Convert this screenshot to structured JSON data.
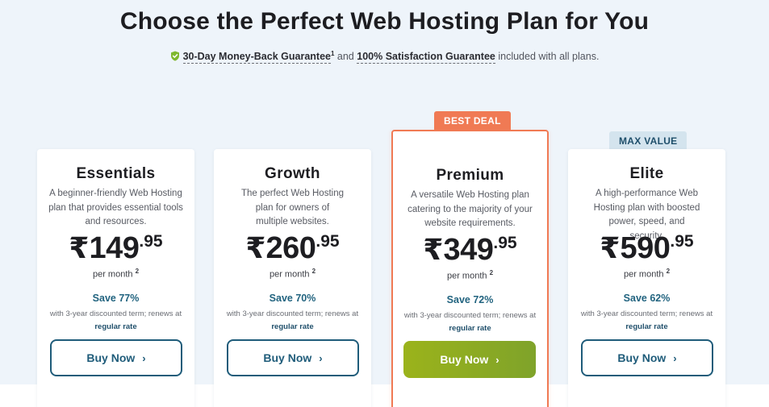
{
  "header": {
    "title": "Choose the Perfect Web Hosting Plan for You",
    "money_back": "30-Day Money-Back Guarantee",
    "money_back_sup": "1",
    "and_text": "and",
    "satisfaction": "100% Satisfaction Guarantee",
    "suffix": "included with all plans."
  },
  "colors": {
    "accent_orange": "#f07a54",
    "brand_blue": "#1f5c7a",
    "buy_green": "#8faf22",
    "shield_green": "#7fb82e"
  },
  "plans": [
    {
      "name": "Essentials",
      "badge": "",
      "description": "A beginner-friendly Web Hosting plan that provides essential tools and resources.",
      "currency": "₹",
      "price_main": "149",
      "price_cents": ".95",
      "per_month": "per month",
      "per_month_sup": "2",
      "save": "Save 77%",
      "terms_text": "with 3-year discounted term; renews at",
      "terms_link": "regular rate",
      "button": "Buy Now"
    },
    {
      "name": "Growth",
      "badge": "",
      "description": "The perfect Web Hosting plan for owners of multiple websites.",
      "currency": "₹",
      "price_main": "260",
      "price_cents": ".95",
      "per_month": "per month",
      "per_month_sup": "2",
      "save": "Save 70%",
      "terms_text": "with 3-year discounted term; renews at",
      "terms_link": "regular rate",
      "button": "Buy Now"
    },
    {
      "name": "Premium",
      "badge": "BEST DEAL",
      "description": "A versatile Web Hosting plan catering to the majority of your website requirements.",
      "currency": "₹",
      "price_main": "349",
      "price_cents": ".95",
      "per_month": "per month",
      "per_month_sup": "2",
      "save": "Save 72%",
      "terms_text": "with 3-year discounted term; renews at",
      "terms_link": "regular rate",
      "button": "Buy Now"
    },
    {
      "name": "Elite",
      "badge": "MAX VALUE",
      "description": "A high-performance Web Hosting plan with boosted power, speed, and security.",
      "currency": "₹",
      "price_main": "590",
      "price_cents": ".95",
      "per_month": "per month",
      "per_month_sup": "2",
      "save": "Save 62%",
      "terms_text": "with 3-year discounted term; renews at",
      "terms_link": "regular rate",
      "button": "Buy Now"
    }
  ]
}
